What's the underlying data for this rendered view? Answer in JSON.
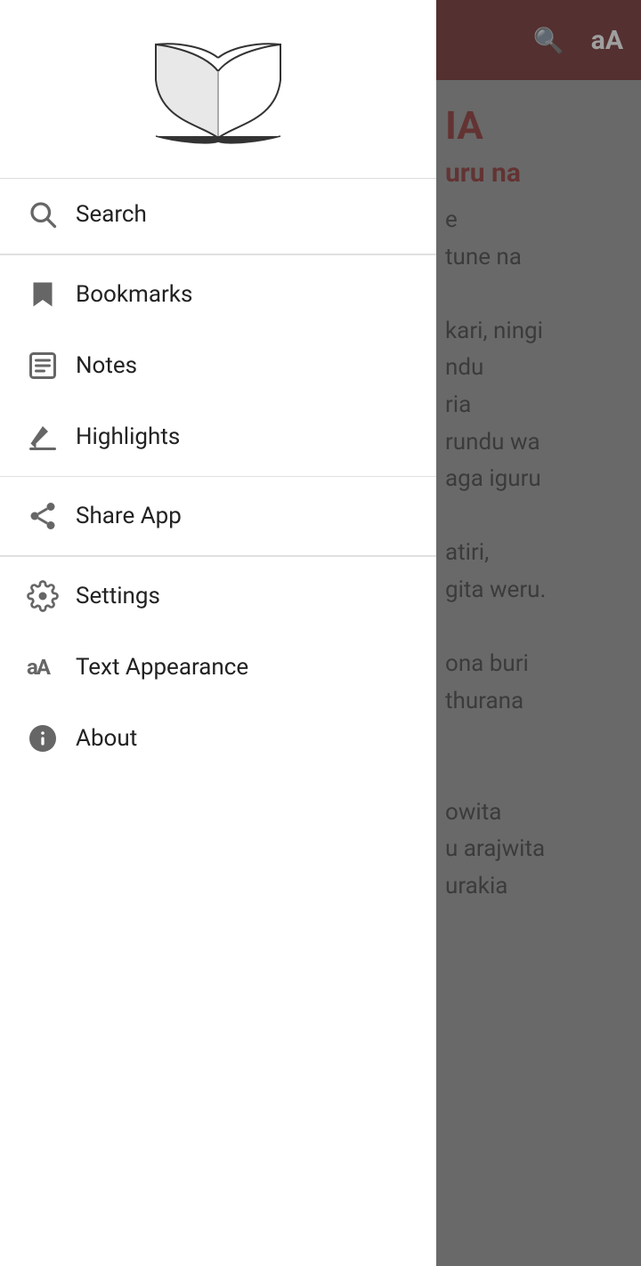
{
  "header": {
    "search_icon": "search",
    "text_size_icon": "aA",
    "background_color": "#5a0a0a"
  },
  "background": {
    "title": "IA",
    "subtitle": "uru na",
    "body_lines": [
      "e",
      "tune na",
      "",
      "kari, ningi",
      "ndu",
      "ria",
      "rundu wa",
      "aga iguru",
      "",
      "atiri,",
      "gita weru.",
      "",
      "ona buri",
      "thurana",
      "",
      "",
      "owita",
      "u arajwita",
      "urakia"
    ]
  },
  "drawer": {
    "logo_alt": "Open Book",
    "menu_items": [
      {
        "id": "search",
        "icon": "search",
        "label": "Search",
        "section_after": true
      },
      {
        "id": "bookmarks",
        "icon": "bookmark",
        "label": "Bookmarks",
        "section_after": false
      },
      {
        "id": "notes",
        "icon": "notes",
        "label": "Notes",
        "section_after": false
      },
      {
        "id": "highlights",
        "icon": "highlight",
        "label": "Highlights",
        "section_after": true
      },
      {
        "id": "share",
        "icon": "share",
        "label": "Share App",
        "section_after": true
      },
      {
        "id": "settings",
        "icon": "settings",
        "label": "Settings",
        "section_after": false
      },
      {
        "id": "text-appearance",
        "icon": "text-size",
        "label": "Text Appearance",
        "section_after": false
      },
      {
        "id": "about",
        "icon": "info",
        "label": "About",
        "section_after": false
      }
    ]
  }
}
